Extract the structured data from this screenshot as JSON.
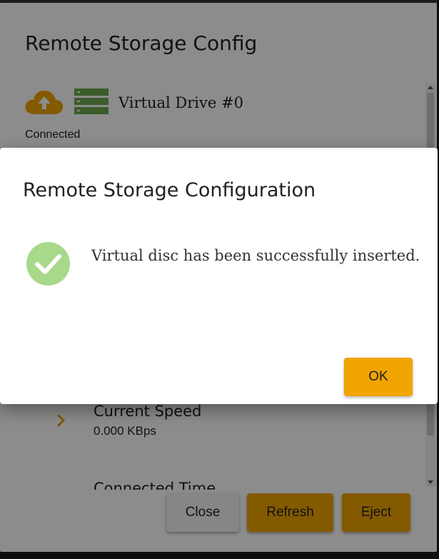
{
  "background": {
    "title": "Remote Storage Config",
    "drive_name": "Virtual Drive #0",
    "status": "Connected",
    "speed_label": "Current Speed",
    "speed_value": "0.000 KBps",
    "partial_label": "Connected Time",
    "buttons": {
      "close": "Close",
      "refresh": "Refresh",
      "eject": "Eject"
    }
  },
  "dialog": {
    "title": "Remote Storage Configuration",
    "message": "Virtual disc has been successfully inserted.",
    "ok_label": "OK"
  },
  "icons": {
    "cloud": "cloud-upload-icon",
    "server": "server-icon",
    "chevron": "chevron-right-icon",
    "check": "check-circle-icon"
  },
  "colors": {
    "accent": "#f0a500",
    "cloud": "#f0a500",
    "server": "#6aa84f",
    "success": "#a8d88a"
  }
}
